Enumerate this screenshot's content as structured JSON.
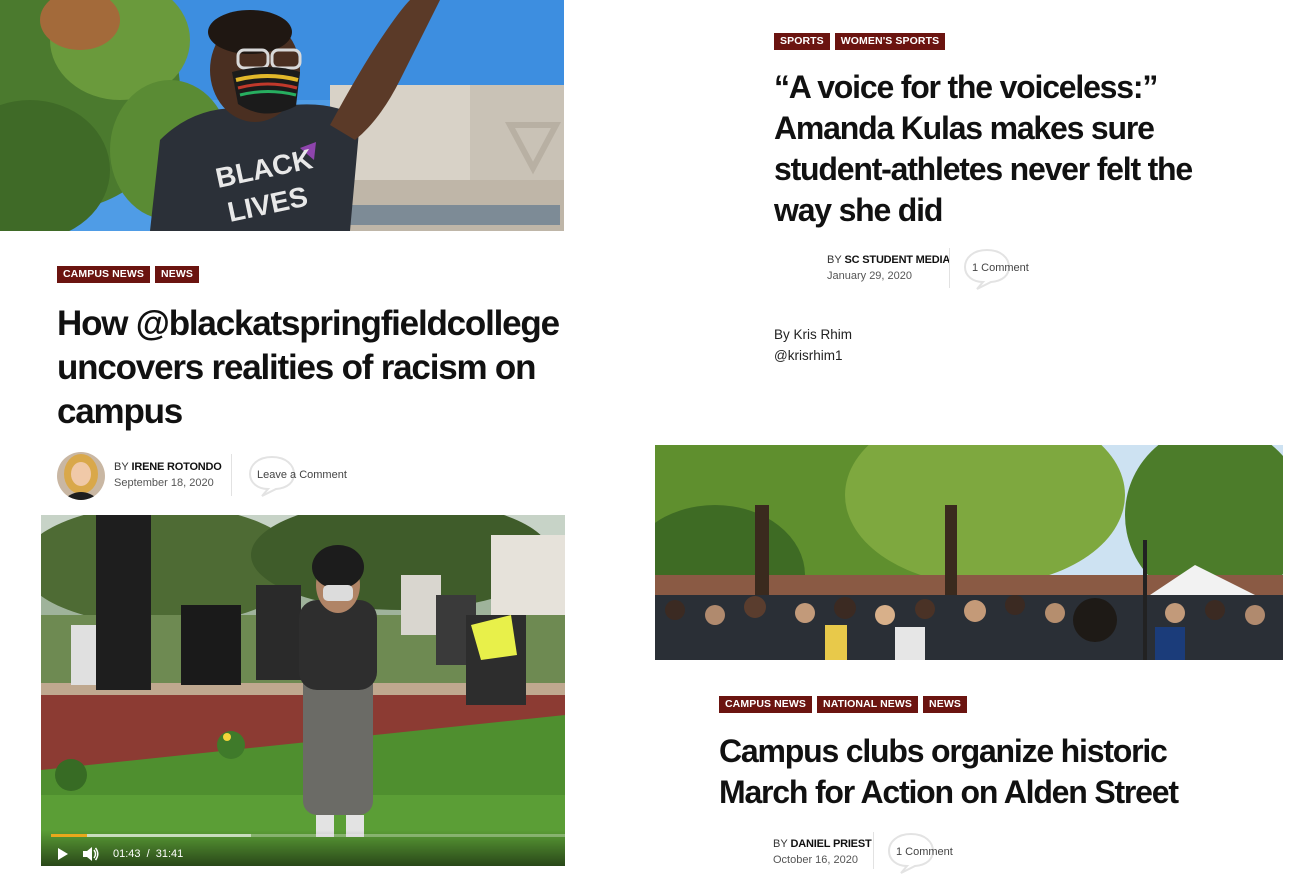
{
  "article1": {
    "tags": [
      "CAMPUS NEWS",
      "NEWS"
    ],
    "title_lines": [
      "How @blackatspringfieldcollege",
      "uncovers realities of racism on",
      "campus"
    ],
    "by": "BY",
    "author": "IRENE ROTONDO",
    "date": "September 18, 2020",
    "comment": "Leave a Comment",
    "photo_shirt_text": [
      "BLACK",
      "LIVES"
    ]
  },
  "video": {
    "time_current": "01:43",
    "time_separator": "/",
    "time_total": "31:41",
    "progress_fraction": 0.07,
    "buffered_fraction": 0.39
  },
  "article2": {
    "tags": [
      "SPORTS",
      "WOMEN'S SPORTS"
    ],
    "title_lines": [
      "“A voice for the voiceless:”",
      "Amanda Kulas makes sure",
      "student-athletes never felt the",
      "way she did"
    ],
    "by": "BY",
    "author": "SC STUDENT MEDIA",
    "date": "January 29, 2020",
    "comment": "1 Comment",
    "body_lines": [
      "By Kris Rhim",
      "@krisrhim1"
    ]
  },
  "article3": {
    "tags": [
      "CAMPUS NEWS",
      "NATIONAL NEWS",
      "NEWS"
    ],
    "title_lines": [
      "Campus clubs organize historic",
      "March for Action on Alden Street"
    ],
    "by": "BY",
    "author": "DANIEL PRIEST",
    "date": "October 16, 2020",
    "comment": "1 Comment"
  },
  "colors": {
    "tag_background": "#6b1410",
    "video_progress": "#e8a81c"
  }
}
